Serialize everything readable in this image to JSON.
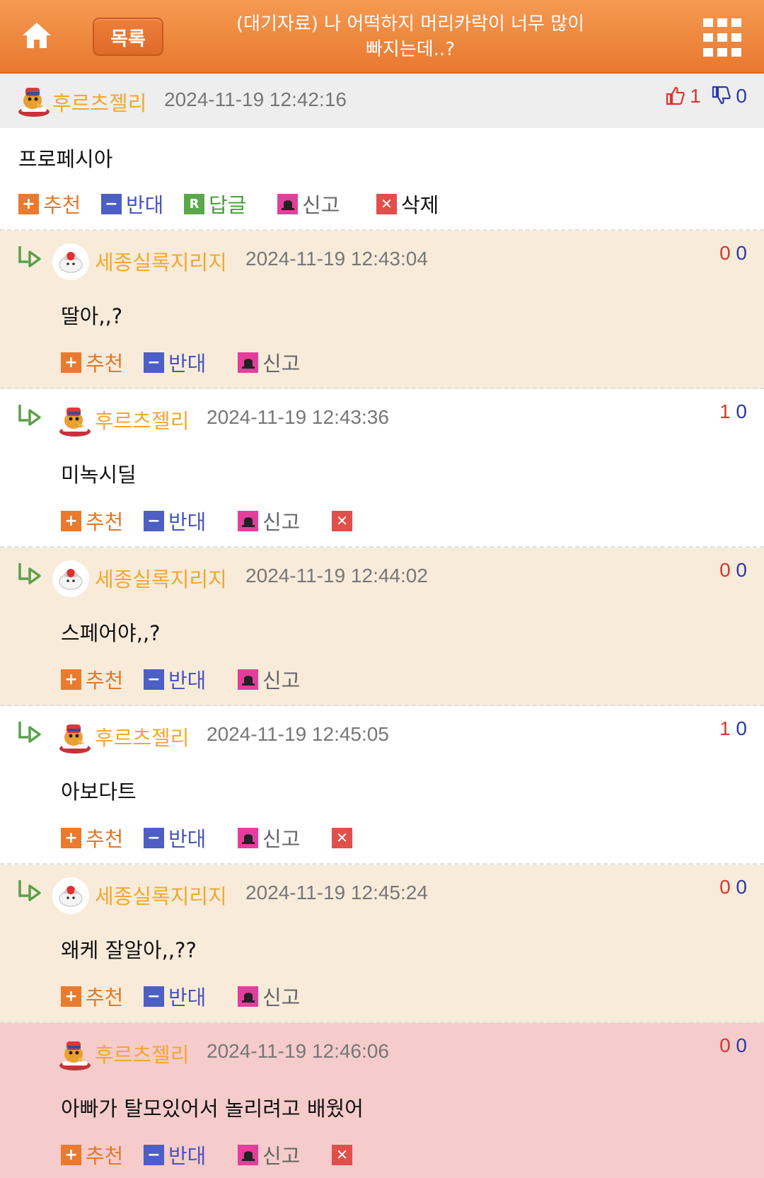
{
  "header": {
    "title_line1": "(대기자료) 나 어떡하지 머리카락이 너무 많이",
    "title_line2": "빠지는데..?",
    "list_label": "목록",
    "home_icon": "home-icon",
    "menu_icon": "grid-menu-icon"
  },
  "actions": {
    "upvote": "추천",
    "downvote": "반대",
    "reply": "답글",
    "report": "신고",
    "delete": "삭제"
  },
  "colors": {
    "header": "#e8782f",
    "nick": "#f0a830",
    "upvote_count": "#d9362d",
    "downvote_count": "#2a3aaa",
    "reply_beige": "#f8ebda",
    "reply_pink": "#f5cbcb"
  },
  "comments": [
    {
      "nick": "후르츠젤리",
      "date": "2024-11-19 12:42:16",
      "up": "1",
      "down": "0",
      "text": "프로페시아"
    },
    {
      "nick": "세종실록지리지",
      "date": "2024-11-19 12:43:04",
      "up": "0",
      "down": "0",
      "text": "딸아,,?"
    },
    {
      "nick": "후르츠젤리",
      "date": "2024-11-19 12:43:36",
      "up": "1",
      "down": "0",
      "text": "미녹시딜"
    },
    {
      "nick": "세종실록지리지",
      "date": "2024-11-19 12:44:02",
      "up": "0",
      "down": "0",
      "text": "스페어야,,?"
    },
    {
      "nick": "후르츠젤리",
      "date": "2024-11-19 12:45:05",
      "up": "1",
      "down": "0",
      "text": "아보다트"
    },
    {
      "nick": "세종실록지리지",
      "date": "2024-11-19 12:45:24",
      "up": "0",
      "down": "0",
      "text": "왜케 잘알아,,??"
    },
    {
      "nick": "후르츠젤리",
      "date": "2024-11-19 12:46:06",
      "up": "0",
      "down": "0",
      "text": "아빠가 탈모있어서 놀리려고 배웠어"
    }
  ]
}
